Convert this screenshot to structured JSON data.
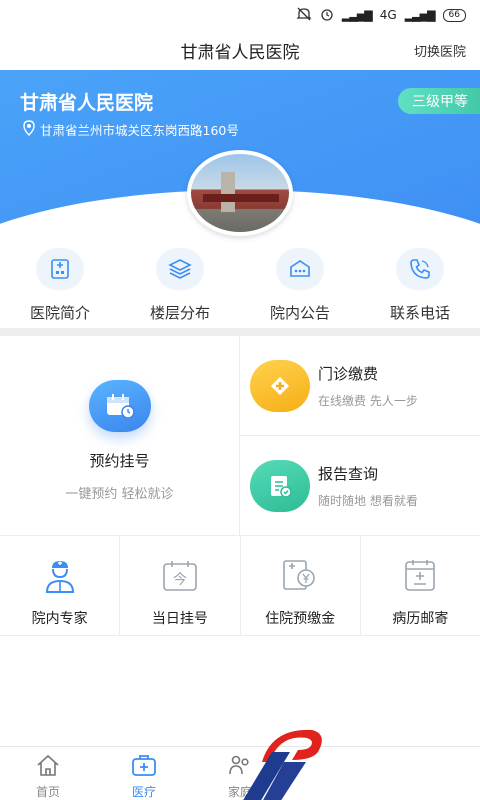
{
  "status_bar": {
    "network": "4G",
    "battery": "66"
  },
  "nav": {
    "title": "甘肃省人民医院",
    "switch_label": "切换医院"
  },
  "hero": {
    "hospital_name": "甘肃省人民医院",
    "address": "甘肃省兰州市城关区东岗西路160号",
    "level_badge": "三级甲等"
  },
  "quick_links": [
    {
      "label": "医院简介",
      "icon": "hospital-info-icon"
    },
    {
      "label": "楼层分布",
      "icon": "layers-icon"
    },
    {
      "label": "院内公告",
      "icon": "notice-icon"
    },
    {
      "label": "联系电话",
      "icon": "phone-icon"
    }
  ],
  "services": {
    "appointment": {
      "title": "预约挂号",
      "subtitle": "一键预约 轻松就诊"
    },
    "payment": {
      "title": "门诊缴费",
      "subtitle": "在线缴费 先人一步"
    },
    "report": {
      "title": "报告查询",
      "subtitle": "随时随地 想看就看"
    }
  },
  "small_services": [
    {
      "label": "院内专家",
      "icon": "doctor-icon"
    },
    {
      "label": "当日挂号",
      "icon": "calendar-today-icon",
      "glyph": "今"
    },
    {
      "label": "住院预缴金",
      "icon": "deposit-icon"
    },
    {
      "label": "病历邮寄",
      "icon": "medical-record-icon"
    }
  ],
  "tabbar": {
    "tabs": [
      {
        "label": "首页",
        "icon": "home-icon"
      },
      {
        "label": "医疗",
        "icon": "medical-kit-icon",
        "active": true
      },
      {
        "label": "家庭",
        "icon": "family-icon"
      }
    ]
  },
  "colors": {
    "primary": "#3a8ef5",
    "badge": "#43c9a8",
    "payment_icon": "#f8b51d",
    "report_icon": "#34c9a1"
  }
}
